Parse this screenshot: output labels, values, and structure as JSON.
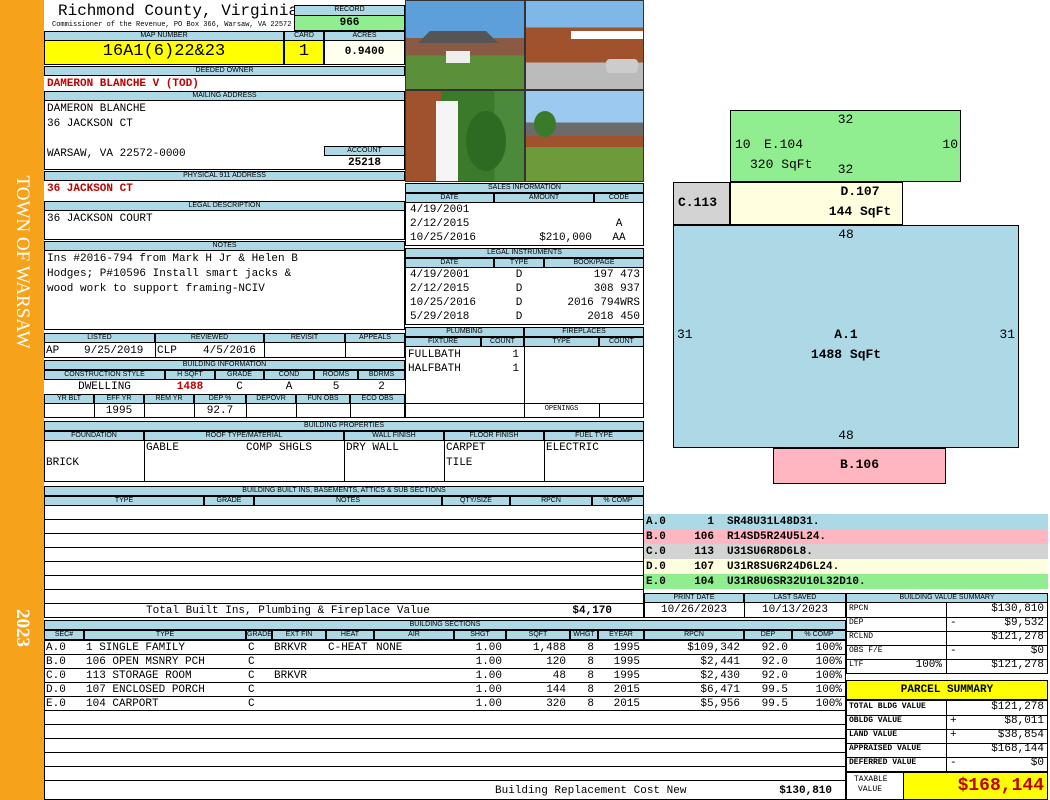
{
  "sideband": {
    "town": "TOWN OF WARSAW",
    "year": "2023"
  },
  "header": {
    "county": "Richmond County, Virginia",
    "address": "Commissioner of the Revenue, PO Box 366, Warsaw, VA 22572"
  },
  "record": {
    "label": "RECORD",
    "value": "966"
  },
  "map": {
    "label": "MAP NUMBER",
    "value": "16A1(6)22&23"
  },
  "card": {
    "label": "CARD",
    "value": "1"
  },
  "acres": {
    "label": "ACRES",
    "value": "0.9400"
  },
  "owner": {
    "label": "DEEDED OWNER",
    "value": "DAMERON BLANCHE V (TOD)"
  },
  "mailing": {
    "label": "MAILING ADDRESS",
    "line1": "DAMERON BLANCHE",
    "line2": "36 JACKSON CT",
    "line3": "WARSAW, VA 22572-0000"
  },
  "account": {
    "label": "ACCOUNT",
    "value": "25218"
  },
  "physical": {
    "label": "PHYSICAL 911 ADDRESS",
    "value": "36 JACKSON CT"
  },
  "legal": {
    "label": "LEGAL DESCRIPTION",
    "value": "36 JACKSON COURT"
  },
  "notes": {
    "label": "NOTES",
    "line1": "Ins #2016-794 from Mark H Jr & Helen B",
    "line2": "Hodges; P#10596 Install smart jacks &",
    "line3": "wood work to support framing-NCIV"
  },
  "listed": {
    "labels": {
      "listed": "LISTED",
      "reviewed": "REVIEWED",
      "revisit": "REVISIT",
      "appeals": "APPEALS"
    },
    "lister": "AP",
    "listed_date": "9/25/2019",
    "reviewer": "CLP",
    "reviewed_date": "4/5/2016"
  },
  "building_info": {
    "label": "BUILDING INFORMATION",
    "cols": {
      "style": "CONSTRUCTION STYLE",
      "hsqft": "H SQFT",
      "grade": "GRADE",
      "cond": "COND",
      "rooms": "ROOMS",
      "bdrms": "BDRMS"
    },
    "style": "DWELLING",
    "hsqft": "1488",
    "grade": "C",
    "cond": "A",
    "rooms": "5",
    "bdrms": "2",
    "cols2": {
      "yrblt": "YR BLT",
      "effyr": "EFF YR",
      "remyr": "REM YR",
      "dep": "DEP %",
      "depovr": "DEPOVR",
      "funobs": "FUN OBS",
      "ecoobs": "ECO OBS"
    },
    "effyr": "1995",
    "dep": "92.7"
  },
  "sales": {
    "label": "SALES INFORMATION",
    "cols": {
      "date": "DATE",
      "amount": "AMOUNT",
      "code": "CODE"
    },
    "rows": [
      {
        "date": "4/19/2001",
        "amount": "",
        "code": ""
      },
      {
        "date": "2/12/2015",
        "amount": "",
        "code": "A"
      },
      {
        "date": "10/25/2016",
        "amount": "$210,000",
        "code": "AA"
      }
    ]
  },
  "instruments": {
    "label": "LEGAL INSTRUMENTS",
    "cols": {
      "date": "DATE",
      "type": "TYPE",
      "book": "BOOK/PAGE"
    },
    "rows": [
      {
        "date": "4/19/2001",
        "type": "D",
        "book": "197 473"
      },
      {
        "date": "2/12/2015",
        "type": "D",
        "book": "308 937"
      },
      {
        "date": "10/25/2016",
        "type": "D",
        "book": "2016 794WRS"
      },
      {
        "date": "5/29/2018",
        "type": "D",
        "book": "2018 450"
      }
    ]
  },
  "plumbing": {
    "label": "PLUMBING",
    "cols": {
      "fixture": "FIXTURE",
      "count": "COUNT"
    },
    "rows": [
      {
        "fixture": "FULLBATH",
        "count": "1"
      },
      {
        "fixture": "HALFBATH",
        "count": "1"
      }
    ]
  },
  "fireplaces": {
    "label": "FIREPLACES",
    "cols": {
      "type": "TYPE",
      "count": "COUNT"
    },
    "openings": "OPENINGS"
  },
  "properties": {
    "label": "BUILDING PROPERTIES",
    "cols": {
      "foundation": "FOUNDATION",
      "roof": "ROOF TYPE/MATERIAL",
      "wall": "WALL FINISH",
      "floor": "FLOOR FINISH",
      "fuel": "FUEL TYPE"
    },
    "foundation": "BRICK",
    "roof_type": "GABLE",
    "roof_mat": "COMP SHGLS",
    "wall": "DRY WALL",
    "floor1": "CARPET",
    "floor2": "TILE",
    "fuel": "ELECTRIC"
  },
  "builtins": {
    "label": "BUILDING BUILT INS, BASEMENTS, ATTICS & SUB SECTIONS",
    "cols": {
      "type": "TYPE",
      "grade": "GRADE",
      "notes": "NOTES",
      "qty": "QTY/SIZE",
      "rpcn": "RPCN",
      "comp": "% COMP"
    },
    "total_label": "Total Built Ins, Plumbing & Fireplace Value",
    "total_value": "$4,170"
  },
  "dates": {
    "print_label": "PRINT DATE",
    "print": "10/26/2023",
    "saved_label": "LAST SAVED",
    "saved": "10/13/2023"
  },
  "sections": {
    "label": "BUILDING SECTIONS",
    "cols": {
      "sec": "SEC#",
      "type": "TYPE",
      "grade": "GRADE",
      "extfin": "EXT FIN",
      "heat": "HEAT",
      "air": "AIR",
      "shgt": "SHGT",
      "sqft": "SQFT",
      "whgt": "WHGT",
      "eyear": "EYEAR",
      "rpcn": "RPCN",
      "dep": "DEP",
      "comp": "% COMP"
    },
    "rows": [
      {
        "sec": "A.0",
        "type": "1 SINGLE FAMILY",
        "grade": "C",
        "extfin": "BRKVR",
        "heat": "C-HEAT",
        "air": "NONE",
        "shgt": "1.00",
        "sqft": "1,488",
        "whgt": "8",
        "eyear": "1995",
        "rpcn": "$109,342",
        "dep": "92.0",
        "comp": "100%"
      },
      {
        "sec": "B.0",
        "type": "106 OPEN MSNRY PCH",
        "grade": "C",
        "extfin": "",
        "heat": "",
        "air": "",
        "shgt": "1.00",
        "sqft": "120",
        "whgt": "8",
        "eyear": "1995",
        "rpcn": "$2,441",
        "dep": "92.0",
        "comp": "100%"
      },
      {
        "sec": "C.0",
        "type": "113 STORAGE ROOM",
        "grade": "C",
        "extfin": "BRKVR",
        "heat": "",
        "air": "",
        "shgt": "1.00",
        "sqft": "48",
        "whgt": "8",
        "eyear": "1995",
        "rpcn": "$2,430",
        "dep": "92.0",
        "comp": "100%"
      },
      {
        "sec": "D.0",
        "type": "107 ENCLOSED PORCH",
        "grade": "C",
        "extfin": "",
        "heat": "",
        "air": "",
        "shgt": "1.00",
        "sqft": "144",
        "whgt": "8",
        "eyear": "2015",
        "rpcn": "$6,471",
        "dep": "99.5",
        "comp": "100%"
      },
      {
        "sec": "E.0",
        "type": "104 CARPORT",
        "grade": "C",
        "extfin": "",
        "heat": "",
        "air": "",
        "shgt": "1.00",
        "sqft": "320",
        "whgt": "8",
        "eyear": "2015",
        "rpcn": "$5,956",
        "dep": "99.5",
        "comp": "100%"
      }
    ],
    "replacement_label": "Building Replacement Cost New",
    "replacement_value": "$130,810"
  },
  "sketch": {
    "e_label": "E.104",
    "e_sqft": "320 SqFt",
    "e_top": "32",
    "e_left": "10",
    "e_right": "10",
    "e_bottom": "32",
    "d_label": "D.107",
    "d_sqft": "144 SqFt",
    "c_label": "C.113",
    "a_label": "A.1",
    "a_sqft": "1488 SqFt",
    "a_top": "48",
    "a_left": "31",
    "a_right": "31",
    "a_bottom": "48",
    "b_label": "B.106",
    "colors": {
      "a": "#add8e6",
      "b": "#ffb6c1",
      "c": "#d3d3d3",
      "d": "#ffffe0",
      "e": "#90ee90"
    }
  },
  "legend": [
    {
      "sec": "A.0",
      "num": "1",
      "path": "SR48U31L48D31.",
      "color": "#add8e6"
    },
    {
      "sec": "B.0",
      "num": "106",
      "path": "R14SD5R24U5L24.",
      "color": "#ffb6c1"
    },
    {
      "sec": "C.0",
      "num": "113",
      "path": "U31SU6R8D6L8.",
      "color": "#d3d3d3"
    },
    {
      "sec": "D.0",
      "num": "107",
      "path": "U31R8SU6R24D6L24.",
      "color": "#ffffe0"
    },
    {
      "sec": "E.0",
      "num": "104",
      "path": "U31R8U6SR32U10L32D10.",
      "color": "#90ee90"
    }
  ],
  "value_summary": {
    "label": "BUILDING VALUE SUMMARY",
    "rpcn_label": "RPCN",
    "rpcn": "$130,810",
    "dep_label": "DEP",
    "dep_sign": "-",
    "dep": "$9,532",
    "rclnd_label": "RCLND",
    "rclnd": "$121,278",
    "obs_label": "OBS F/E",
    "obs_sign": "-",
    "obs": "$0",
    "ltf_label": "LTF",
    "ltf_pct": "100%",
    "ltf": "$121,278"
  },
  "parcel": {
    "title": "PARCEL SUMMARY",
    "tbv_label": "TOTAL BLDG VALUE",
    "tbv": "$121,278",
    "obldg_label": "OBLDG VALUE",
    "obldg_sign": "+",
    "obldg": "$8,011",
    "land_label": "LAND VALUE",
    "land_sign": "+",
    "land": "$38,854",
    "appr_label": "APPRAISED VALUE",
    "appr": "$168,144",
    "def_label": "DEFERRED VALUE",
    "def_sign": "-",
    "def": "$0",
    "taxable_label1": "TAXABLE",
    "taxable_label2": "VALUE",
    "taxable": "$168,144"
  }
}
